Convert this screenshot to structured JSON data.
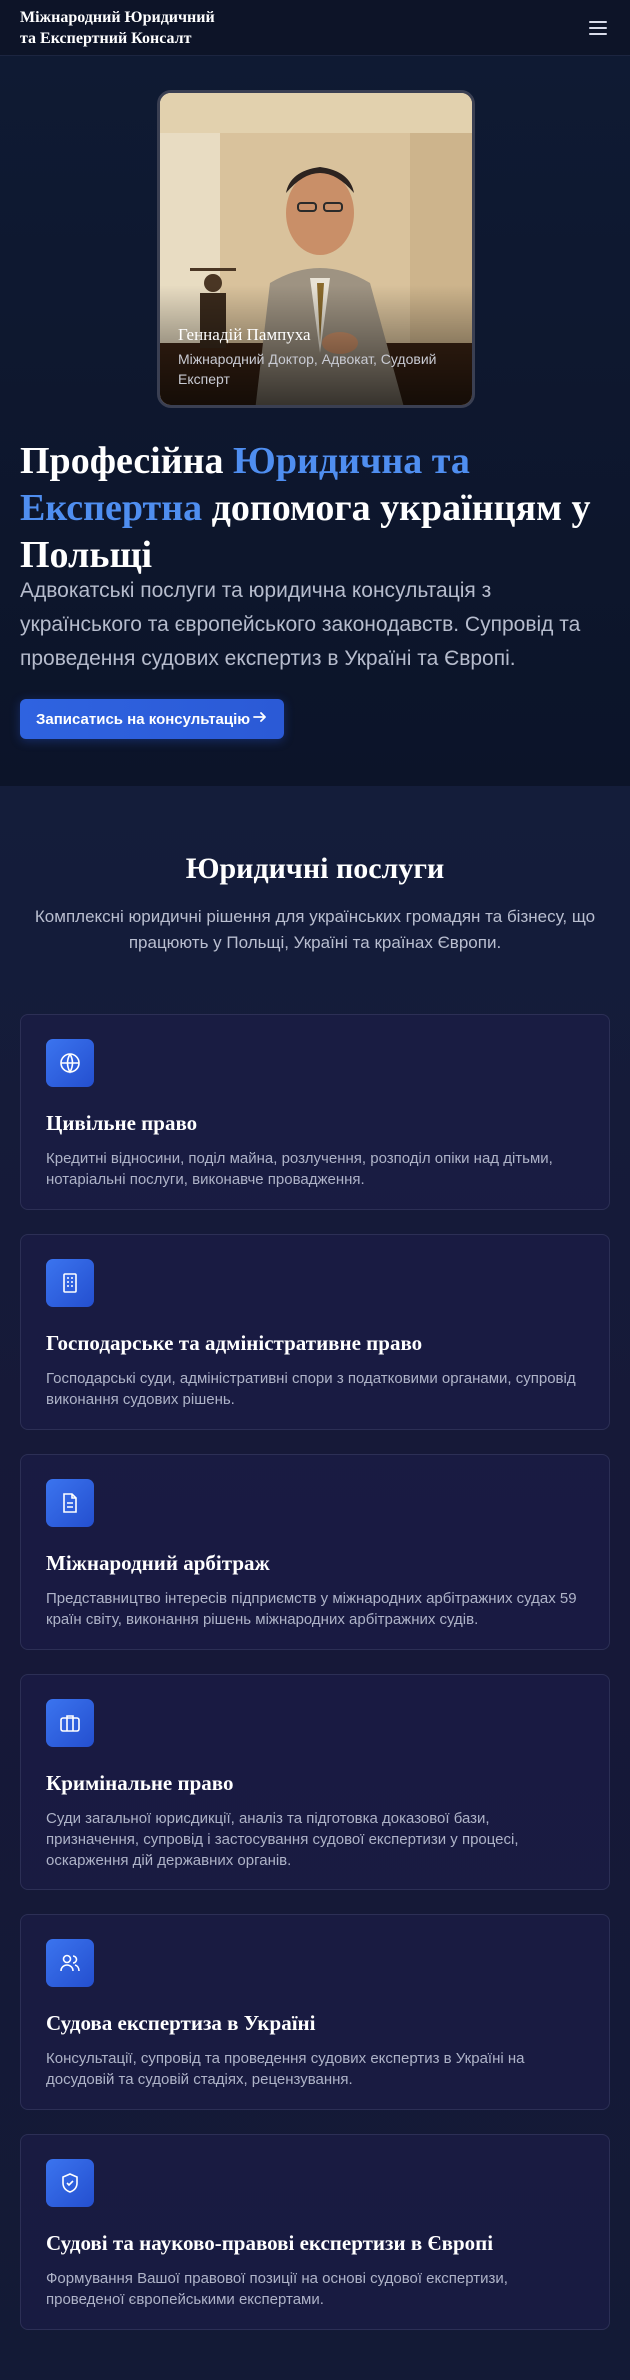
{
  "header": {
    "logo_line1": "Міжнародний Юридичний",
    "logo_line2": "та Експертний Консалт",
    "menu_icon": "hamburger-icon"
  },
  "hero": {
    "photo_name": "Геннадій Пампуха",
    "photo_role": "Міжнародний Доктор, Адвокат, Судовий Експерт",
    "title_part1": "Професійна ",
    "title_accent": "Юридична та Експертна",
    "title_part2": " допомога українцям у Польщі",
    "lead": "Адвокатські послуги та юридична консультація з українського та європейського законодавств. Супровід та проведення судових експертиз в Україні та Європі.",
    "cta_label": "Записатись на консультацію",
    "cta_icon": "arrow-right-icon"
  },
  "services": {
    "title": "Юридичні послуги",
    "subtitle": "Комплексні юридичні рішення для українських громадян та бізнесу, що працюють у Польщі, Україні та країнах Європи.",
    "items": [
      {
        "icon": "globe-icon",
        "title": "Цивільне право",
        "text": "Кредитні відносини, поділ майна, розлучення, розподіл опіки над дітьми, нотаріальні послуги, виконавче провадження."
      },
      {
        "icon": "building-icon",
        "title": "Господарське та адміністративне право",
        "text": "Господарські суди, адміністративні спори з податковими органами, супровід виконання судових рішень."
      },
      {
        "icon": "document-icon",
        "title": "Міжнародний арбітраж",
        "text": "Представництво інтересів підприємств у міжнародних арбітражних судах 59 країн світу, виконання рішень міжнародних арбітражних судів."
      },
      {
        "icon": "briefcase-icon",
        "title": "Кримінальне право",
        "text": "Суди загальної юрисдикції, аналіз та підготовка доказової бази, призначення, супровід і застосування судової експертизи у процесі, оскарження дій державних органів."
      },
      {
        "icon": "users-icon",
        "title": "Судова експертиза в Україні",
        "text": "Консультації, супровід та проведення судових експертиз в Україні на досудовій та судовій стадіях, рецензування."
      },
      {
        "icon": "shield-check-icon",
        "title": "Судові та науково-правові експертизи в Європі",
        "text": "Формування Вашої правової позиції на основі судової експертизи, проведеної європейськими експертами."
      }
    ]
  }
}
